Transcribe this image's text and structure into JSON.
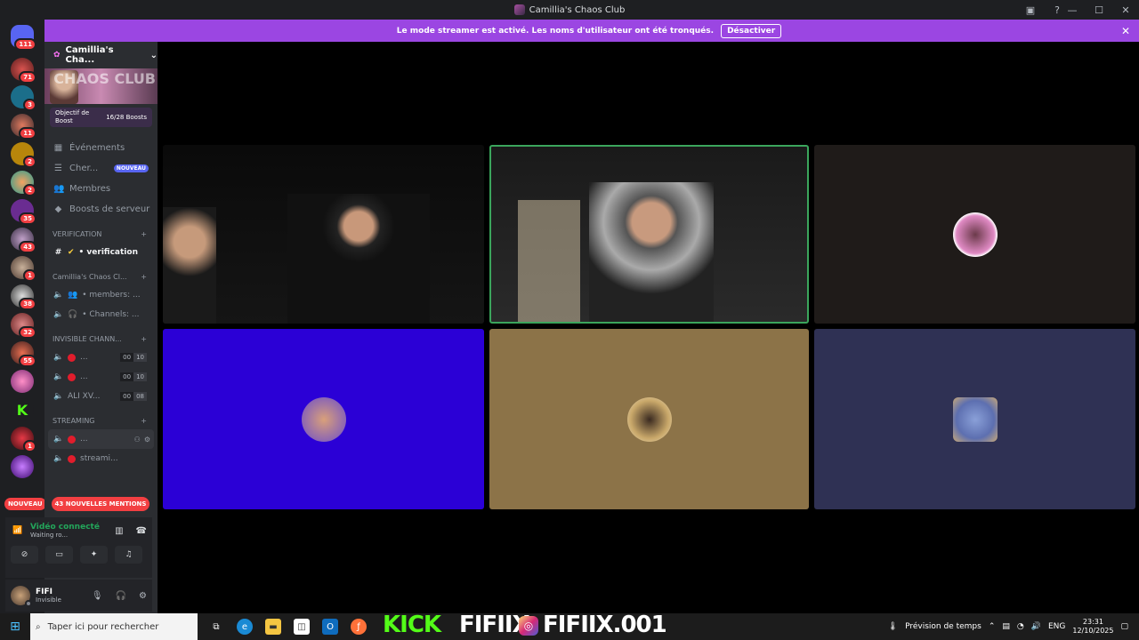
{
  "window": {
    "title": "Camillia's Chaos Club"
  },
  "banner": {
    "text": "Le mode streamer est activé. Les noms d'utilisateur ont été tronqués.",
    "button": "Désactiver"
  },
  "rail": {
    "home_badge": "111",
    "badges": [
      "71",
      "3",
      "11",
      "2",
      "2",
      "35",
      "43",
      "1",
      "38",
      "32",
      "55",
      "",
      "",
      "1",
      "",
      ""
    ],
    "new_label": "NOUVEAU"
  },
  "server": {
    "name": "Camillia's Cha...",
    "banner_text": "CHAOS CLUB",
    "boost_goal": "Objectif de Boost",
    "boost_count": "16/28 Boosts"
  },
  "nav": [
    {
      "icon": "calendar-icon",
      "label": "Événements"
    },
    {
      "icon": "search-icon",
      "label": "Cher...",
      "badge": "NOUVEAU"
    },
    {
      "icon": "members-icon",
      "label": "Membres"
    },
    {
      "icon": "boost-icon",
      "label": "Boosts de serveur"
    }
  ],
  "categories": {
    "verification": "VERIFICATION",
    "chaos": "Camillia's Chaos Cl...",
    "invisible": "INVISIBLE CHANN...",
    "streaming": "STREAMING"
  },
  "channels": {
    "verification": "• verification",
    "members": "• members: ...",
    "channels_count": "• Channels: ...",
    "inv1": {
      "label": "...",
      "count": "00",
      "limit": "10"
    },
    "inv2": {
      "label": "...",
      "count": "00",
      "limit": "10"
    },
    "inv3": {
      "label": "ALI XV...",
      "count": "00",
      "limit": "08"
    },
    "stream1": "...",
    "stream2": "streami..."
  },
  "mentions": "43 NOUVELLES MENTIONS",
  "voice": {
    "status": "Vidéo connecté",
    "sub": "Waiting ro..."
  },
  "user": {
    "name": "FIFI",
    "status": "Invisible"
  },
  "taskbar": {
    "search_placeholder": "Taper ici pour rechercher",
    "kick": "KICK",
    "kick_name": "FIFIIX",
    "ig_name": "FIFIIX.001",
    "weather": "Prévision de temps",
    "lang": "ENG",
    "time": "23:31",
    "date": "12/10/2025"
  },
  "colors": {
    "accent": "#9b46e2",
    "voice_green": "#23a55a",
    "mention_red": "#f23f42",
    "tile_blue": "#2b00d6",
    "tile_tan": "#8c7348",
    "tile_slate": "#2f3154"
  }
}
